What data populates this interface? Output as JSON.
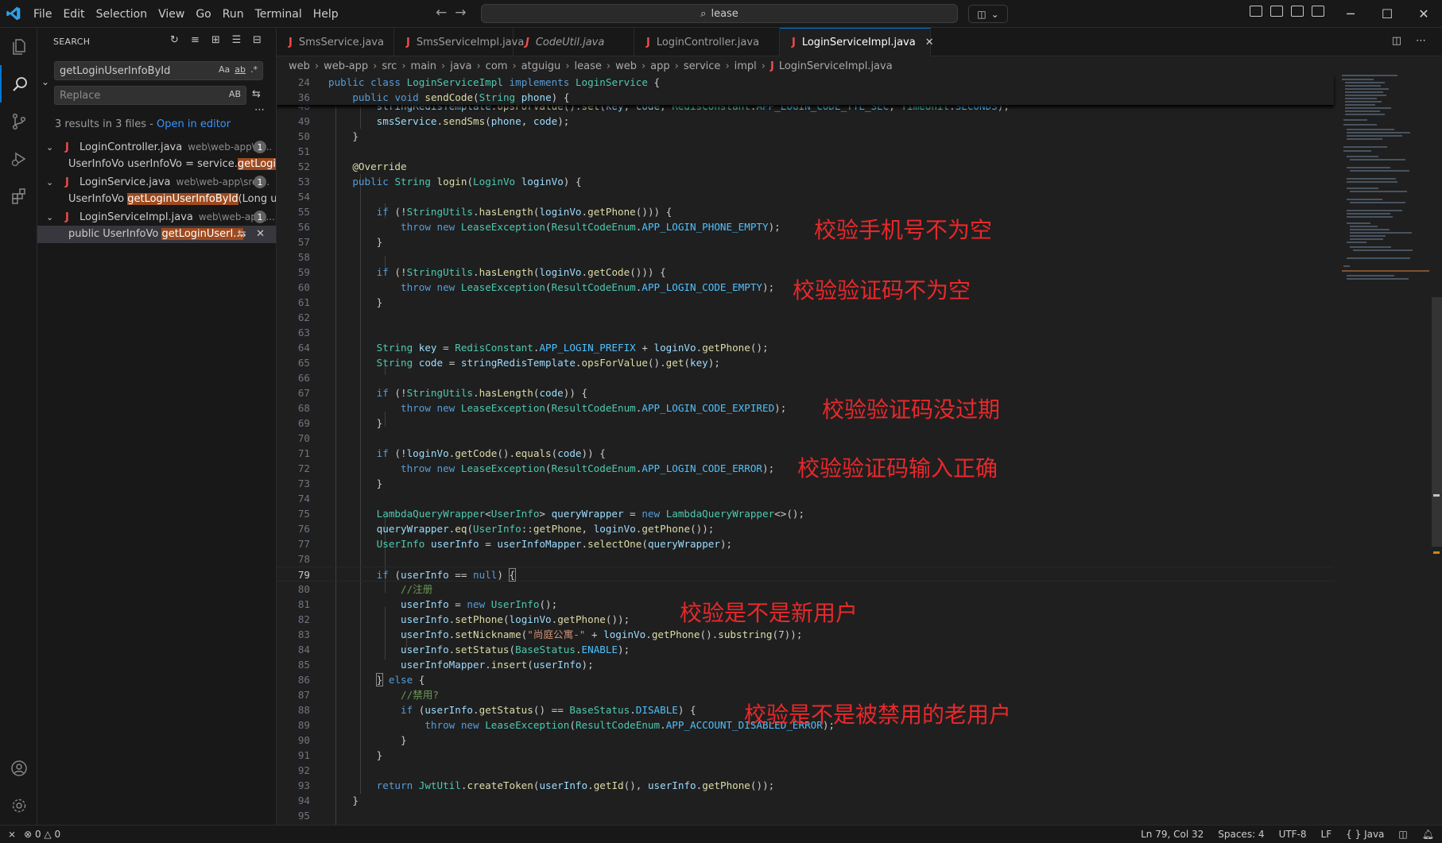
{
  "titlebar": {
    "menu": [
      "File",
      "Edit",
      "Selection",
      "View",
      "Go",
      "Run",
      "Terminal",
      "Help"
    ],
    "search_text": "lease"
  },
  "sidebar": {
    "title": "SEARCH",
    "search_value": "getLoginUserInfoById",
    "replace_placeholder": "Replace",
    "case_label": "Aa",
    "word_label": "ab",
    "regex_label": ".*",
    "preserve_case_label": "AB",
    "summary_text": "3 results in 3 files - ",
    "open_in_editor": "Open in editor",
    "results": [
      {
        "file": "LoginController.java",
        "path": "web\\web-app\\sr...",
        "count": "1",
        "pre": "UserInfoVo userInfoVo = service.",
        "match": "getLoginUs...",
        "post": ""
      },
      {
        "file": "LoginService.java",
        "path": "web\\web-app\\src\\...",
        "count": "1",
        "pre": "UserInfoVo ",
        "match": "getLoginUserInfoById",
        "post": "(Long user..."
      },
      {
        "file": "LoginServiceImpl.java",
        "path": "web\\web-app\\...",
        "count": "1",
        "pre": "public UserInfoVo ",
        "match": "getLoginUserI...",
        "post": ""
      }
    ]
  },
  "tabs": [
    {
      "label": "SmsService.java"
    },
    {
      "label": "SmsServiceImpl.java"
    },
    {
      "label": "CodeUtil.java"
    },
    {
      "label": "LoginController.java"
    },
    {
      "label": "LoginServiceImpl.java"
    }
  ],
  "breadcrumb": [
    "web",
    "web-app",
    "src",
    "main",
    "java",
    "com",
    "atguigu",
    "lease",
    "web",
    "app",
    "service",
    "impl",
    "LoginServiceImpl.java"
  ],
  "annotations": [
    "校验手机号不为空",
    "校验验证码不为空",
    "校验验证码没过期",
    "校验验证码输入正确",
    "校验是不是新用户",
    "校验是不是被禁用的老用户"
  ],
  "statusbar": {
    "errors": "0",
    "warnings": "0",
    "position": "Ln 79, Col 32",
    "spaces": "Spaces: 4",
    "encoding": "UTF-8",
    "eol": "LF",
    "language": "Java"
  },
  "colors": {
    "accent": "#0078d4",
    "annotation": "#e8282b",
    "match_highlight": "#9e4a1f",
    "java_icon": "#f14c4c"
  }
}
